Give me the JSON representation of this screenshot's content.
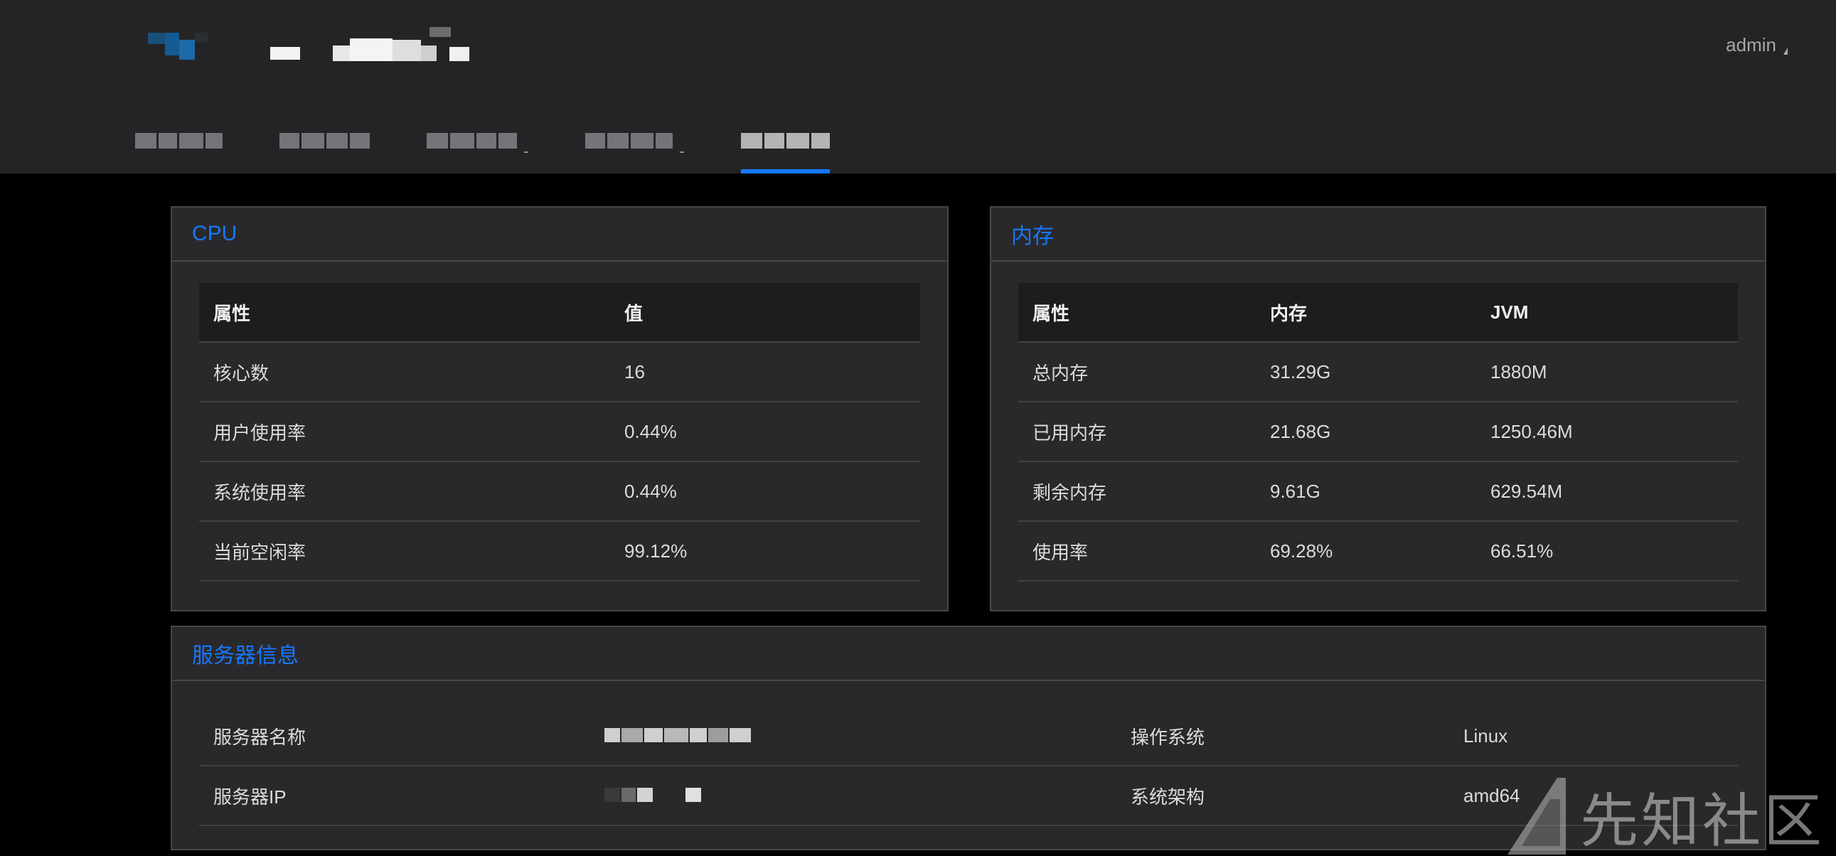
{
  "header": {
    "user": "admin"
  },
  "nav": {
    "items": [
      {
        "label": "",
        "active": false
      },
      {
        "label": "",
        "active": false
      },
      {
        "label": "",
        "active": false
      },
      {
        "label": "",
        "active": false
      },
      {
        "label": "",
        "active": true
      }
    ]
  },
  "cpu": {
    "title": "CPU",
    "headers": [
      "属性",
      "值"
    ],
    "rows": [
      [
        "核心数",
        "16"
      ],
      [
        "用户使用率",
        "0.44%"
      ],
      [
        "系统使用率",
        "0.44%"
      ],
      [
        "当前空闲率",
        "99.12%"
      ]
    ]
  },
  "memory": {
    "title": "内存",
    "headers": [
      "属性",
      "内存",
      "JVM"
    ],
    "rows": [
      [
        "总内存",
        "31.29G",
        "1880M"
      ],
      [
        "已用内存",
        "21.68G",
        "1250.46M"
      ],
      [
        "剩余内存",
        "9.61G",
        "629.54M"
      ],
      [
        "使用率",
        "69.28%",
        "66.51%"
      ]
    ]
  },
  "server": {
    "title": "服务器信息",
    "rows": [
      {
        "label": "服务器名称",
        "value": "",
        "label2": "操作系统",
        "value2": "Linux"
      },
      {
        "label": "服务器IP",
        "value": "",
        "label2": "系统架构",
        "value2": "amd64"
      }
    ]
  },
  "watermark": "先知社区",
  "colors": {
    "accent": "#1677ff",
    "topbar": "#242426",
    "panel": "#29292b",
    "page_bg": "#000000"
  }
}
